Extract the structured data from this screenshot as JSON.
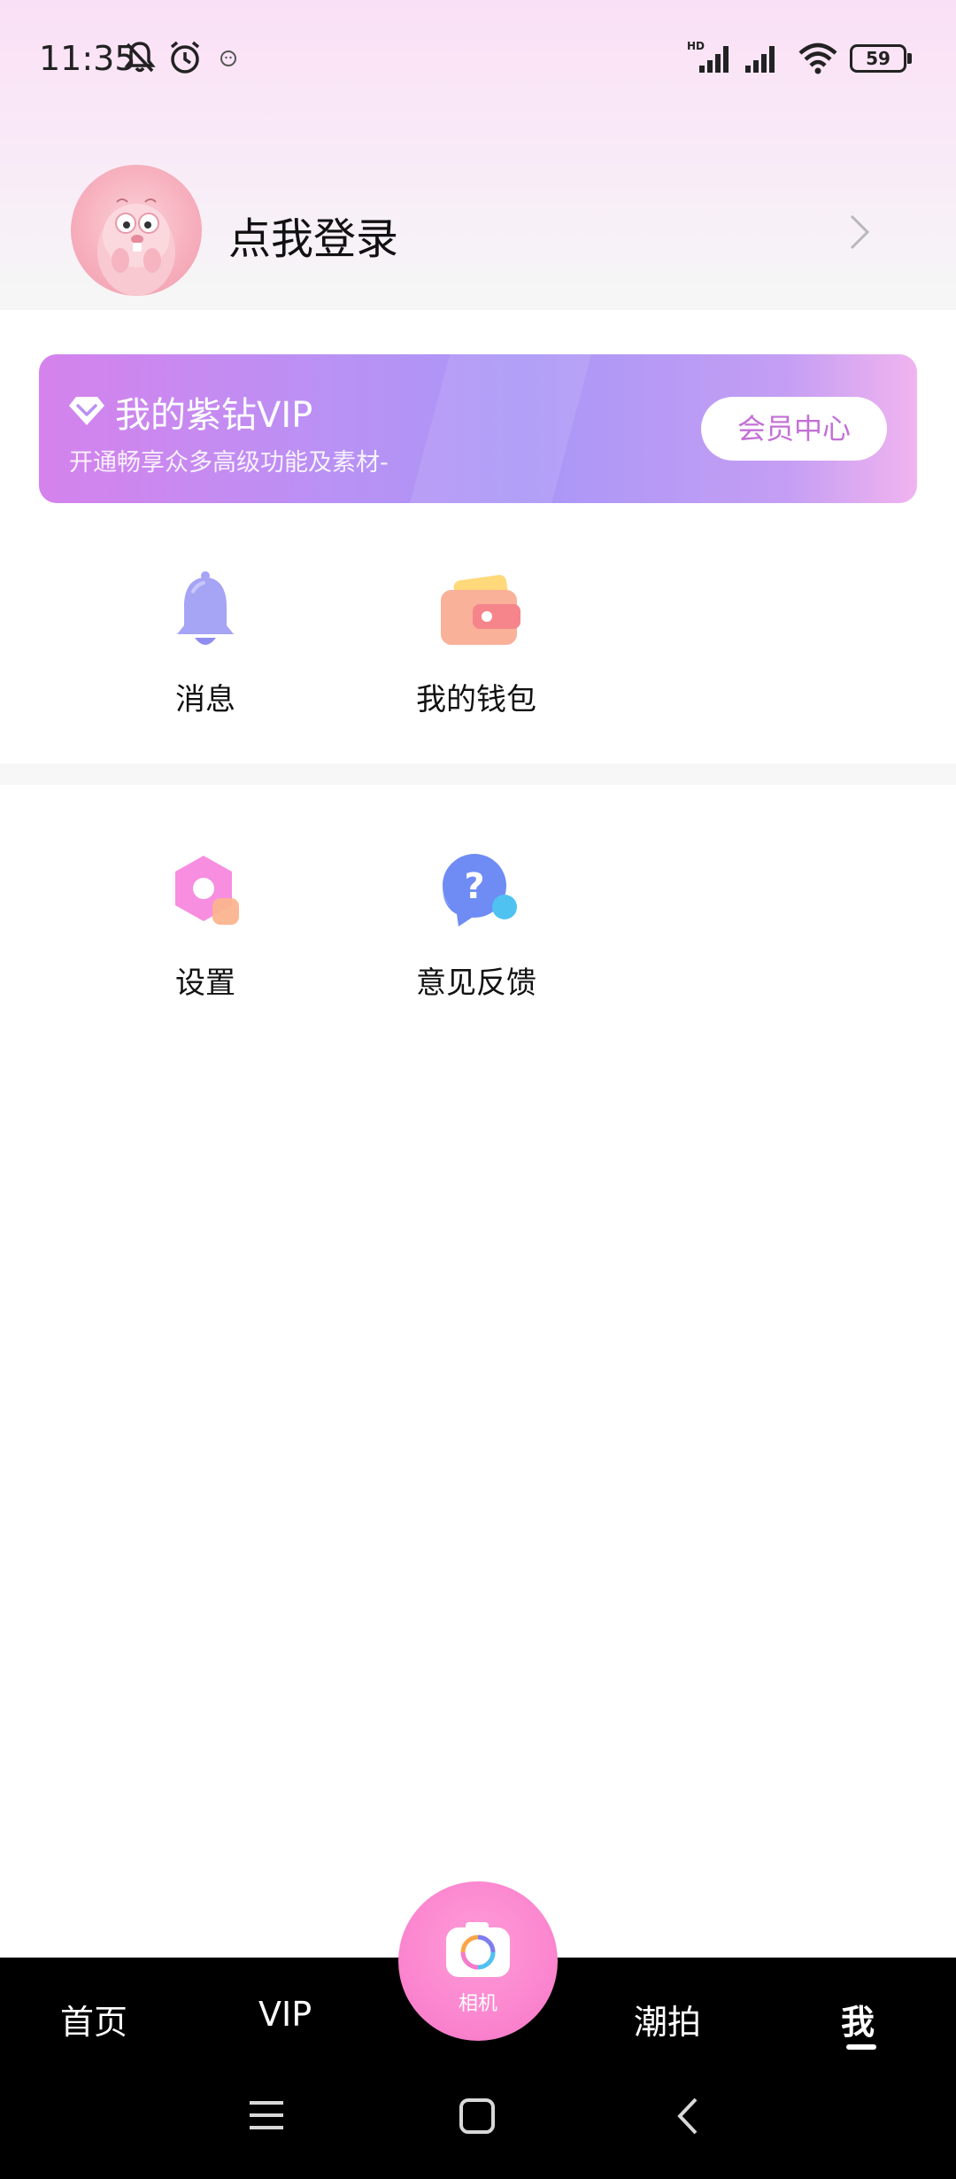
{
  "status_bar": {
    "time": "11:35",
    "battery_level": "59",
    "icons": [
      "bell-off-icon",
      "alarm-icon",
      "app-notification-icon",
      "hd-signal-icon",
      "signal-icon",
      "wifi-icon",
      "battery-icon"
    ]
  },
  "profile": {
    "login_text": "点我登录"
  },
  "vip_card": {
    "title": "我的紫钻VIP",
    "subtitle": "开通畅享众多高级功能及素材-",
    "button_label": "会员中心"
  },
  "features": {
    "row1": [
      {
        "label": "消息",
        "icon": "bell-icon"
      },
      {
        "label": "我的钱包",
        "icon": "wallet-icon"
      }
    ],
    "row2": [
      {
        "label": "设置",
        "icon": "settings-icon"
      },
      {
        "label": "意见反馈",
        "icon": "feedback-icon"
      }
    ]
  },
  "bottom_nav": {
    "tabs": [
      {
        "label": "首页"
      },
      {
        "label": "VIP"
      },
      {
        "label": "潮拍"
      },
      {
        "label": "我"
      }
    ],
    "camera_label": "相机",
    "active_tab": "我"
  },
  "colors": {
    "accent_pink": "#fb86cf",
    "vip_purple": "#b892f5",
    "vip_button_text": "#c370d6"
  }
}
